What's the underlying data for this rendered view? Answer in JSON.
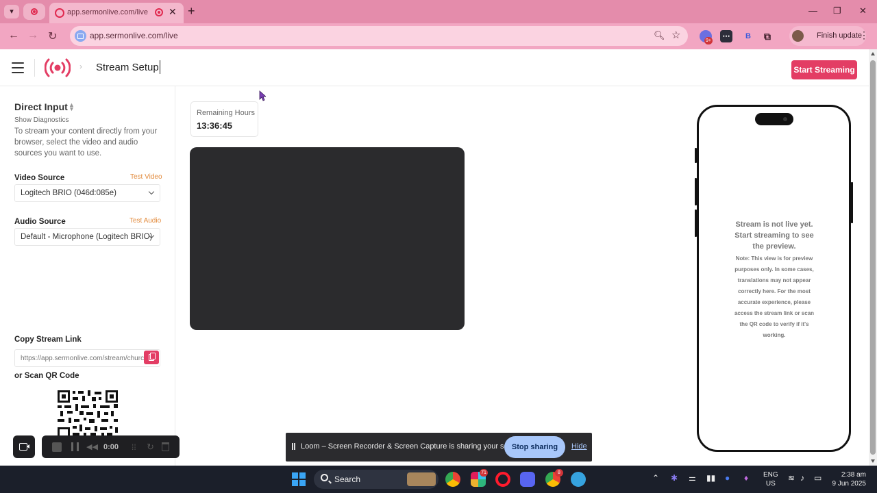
{
  "browser": {
    "tab_title": "app.sermonlive.com/live",
    "url": "app.sermonlive.com/live",
    "finish_update_label": "Finish update",
    "extension_badge": "9+",
    "extension_b_label": "B",
    "window_controls": {
      "minimize": "—",
      "maximize": "❐",
      "close": "✕"
    }
  },
  "header": {
    "page_title": "Stream Setup",
    "breadcrumb_separator": "›",
    "start_button_label": "Start Streaming"
  },
  "left_panel": {
    "title": "Direct Input",
    "diagnostics_link": "Show Diagnostics",
    "description": "To stream your content directly from your browser, select the video and audio sources you want to use.",
    "video_source_label": "Video Source",
    "video_test_link": "Test Video",
    "video_source_value": "Logitech BRIO (046d:085e)",
    "audio_source_label": "Audio Source",
    "audio_test_link": "Test Audio",
    "audio_source_value": "Default - Microphone (Logitech BRIO)",
    "copy_link_label": "Copy Stream Link",
    "stream_link_placeholder": "https://app.sermonlive.com/stream/church",
    "qr_label": "or Scan QR Code"
  },
  "main": {
    "remaining_hours_label": "Remaining Hours",
    "remaining_hours_value": "13:36:45"
  },
  "phone_preview": {
    "status_message": "Stream is not live yet. Start streaming to see the preview.",
    "note": "Note: This view is for preview purposes only. In some cases, translations may not appear correctly here. For the most accurate experience, please access the stream link or scan the QR code to verify if it's working."
  },
  "loom": {
    "timer": "0:00",
    "sharing_message": "Loom – Screen Recorder & Screen Capture is sharing your screen.",
    "stop_sharing_label": "Stop sharing",
    "hide_label": "Hide"
  },
  "taskbar": {
    "search_label": "Search",
    "badge_slack": "71",
    "badge_chrome": "8",
    "language_line1": "ENG",
    "language_line2": "US",
    "time": "2:38 am",
    "date": "9 Jun 2025"
  },
  "colors": {
    "accent": "#e33d64",
    "test_link": "#e28a3b",
    "browser_frame": "#e48cab",
    "taskbar": "#1b1f2a"
  }
}
